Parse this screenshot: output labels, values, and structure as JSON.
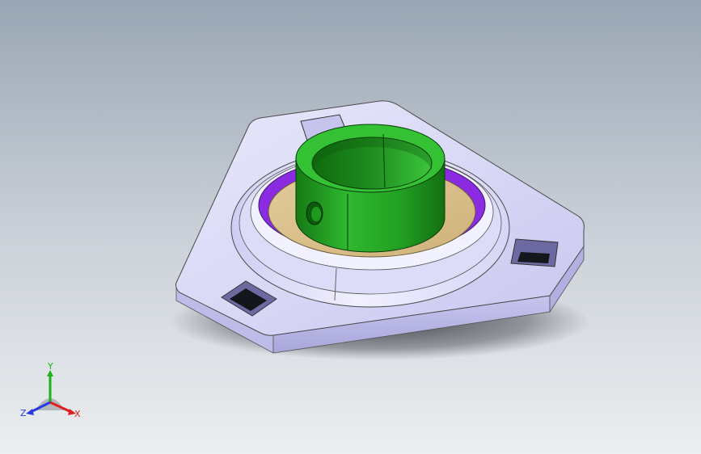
{
  "viewport": {
    "background_top": "#9aa6b4",
    "background_bottom": "#e9ebee"
  },
  "model": {
    "flange_color": "#d8d7f6",
    "collar_color": "#1f9a1f",
    "inner_ring_color": "#d9bf8a",
    "seal_color": "#8a2be2"
  },
  "triad": {
    "x_label": "X",
    "y_label": "Y",
    "z_label": "Z",
    "x_color": "#e02020",
    "y_color": "#19b219",
    "z_color": "#2b3ae0"
  }
}
